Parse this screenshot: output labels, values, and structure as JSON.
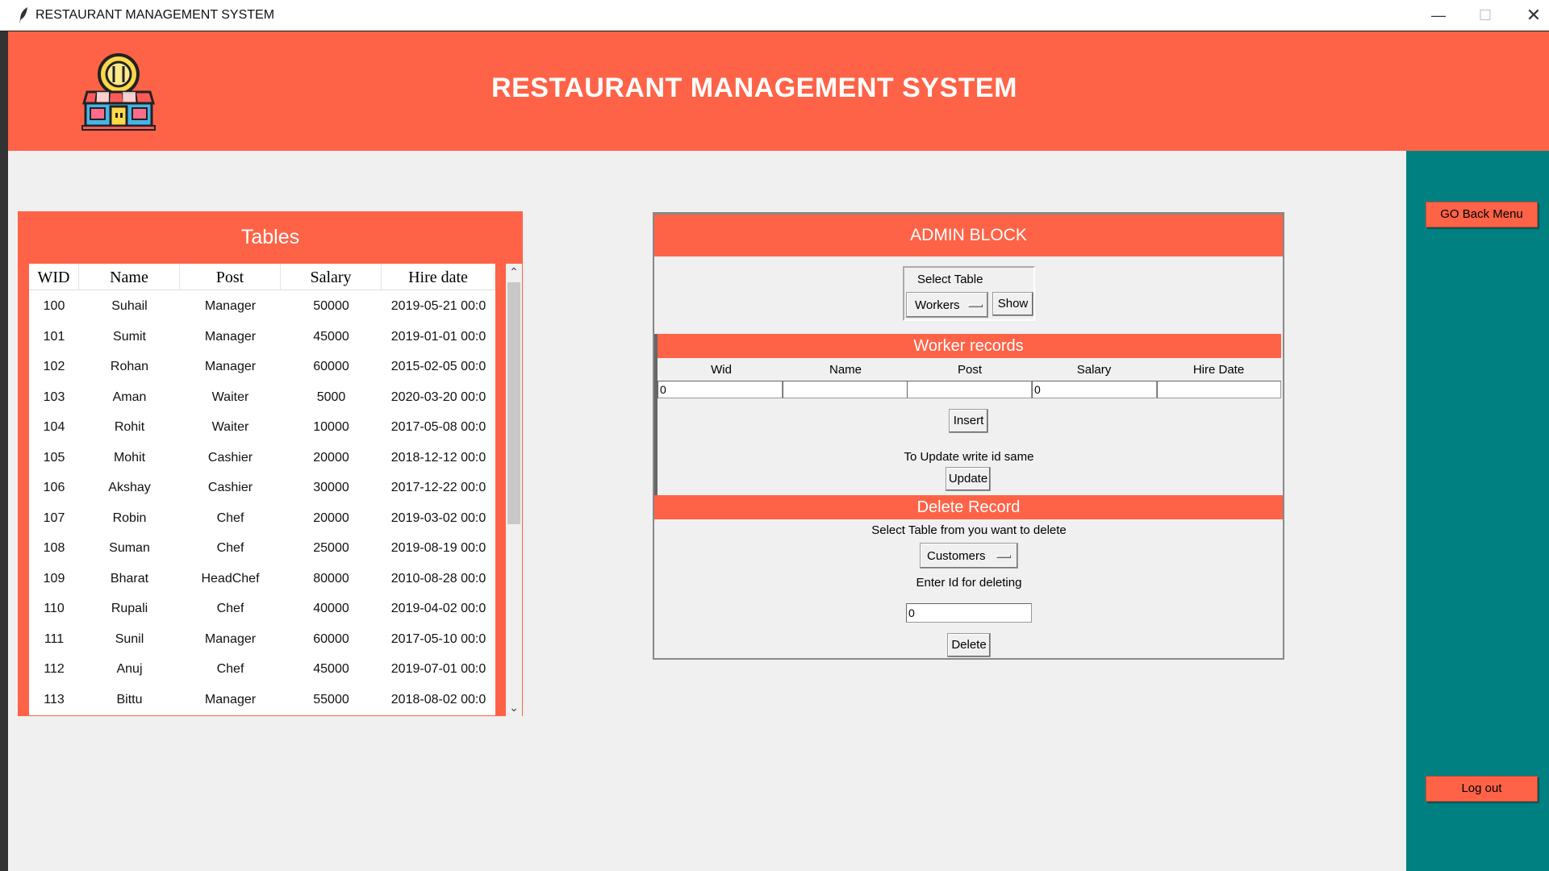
{
  "window": {
    "title": "RESTAURANT MANAGEMENT SYSTEM",
    "minimize": "—",
    "maximize": "☐",
    "close": "✕"
  },
  "header": {
    "title": "RESTAURANT MANAGEMENT SYSTEM"
  },
  "side": {
    "back_label": "GO Back Menu",
    "logout_label": "Log out"
  },
  "tables": {
    "title": "Tables",
    "columns": [
      "WID",
      "Name",
      "Post",
      "Salary",
      "Hire date"
    ],
    "rows": [
      [
        "100",
        "Suhail",
        "Manager",
        "50000",
        "2019-05-21 00:0"
      ],
      [
        "101",
        "Sumit",
        "Manager",
        "45000",
        "2019-01-01 00:0"
      ],
      [
        "102",
        "Rohan",
        "Manager",
        "60000",
        "2015-02-05 00:0"
      ],
      [
        "103",
        "Aman",
        "Waiter",
        "5000",
        "2020-03-20 00:0"
      ],
      [
        "104",
        "Rohit",
        "Waiter",
        "10000",
        "2017-05-08 00:0"
      ],
      [
        "105",
        "Mohit",
        "Cashier",
        "20000",
        "2018-12-12 00:0"
      ],
      [
        "106",
        "Akshay",
        "Cashier",
        "30000",
        "2017-12-22 00:0"
      ],
      [
        "107",
        "Robin",
        "Chef",
        "20000",
        "2019-03-02 00:0"
      ],
      [
        "108",
        "Suman",
        "Chef",
        "25000",
        "2019-08-19 00:0"
      ],
      [
        "109",
        "Bharat",
        "HeadChef",
        "80000",
        "2010-08-28 00:0"
      ],
      [
        "110",
        "Rupali",
        "Chef",
        "40000",
        "2019-04-02 00:0"
      ],
      [
        "111",
        "Sunil",
        "Manager",
        "60000",
        "2017-05-10 00:0"
      ],
      [
        "112",
        "Anuj",
        "Chef",
        "45000",
        "2019-07-01 00:0"
      ],
      [
        "113",
        "Bittu",
        "Manager",
        "55000",
        "2018-08-02 00:0"
      ]
    ]
  },
  "admin": {
    "title": "ADMIN BLOCK",
    "select_table_label": "Select Table",
    "select_table_value": "Workers",
    "show_label": "Show",
    "records_title": "Worker records",
    "fields": [
      {
        "label": "Wid",
        "value": "0"
      },
      {
        "label": "Name",
        "value": ""
      },
      {
        "label": "Post",
        "value": ""
      },
      {
        "label": "Salary",
        "value": "0"
      },
      {
        "label": "Hire Date",
        "value": ""
      }
    ],
    "insert_label": "Insert",
    "update_note": "To Update write id same",
    "update_label": "Update",
    "delete_title": "Delete Record",
    "delete_note": "Select Table from you want to delete",
    "delete_table_value": "Customers",
    "id_note": "Enter Id for deleting",
    "delete_id_value": "0",
    "delete_label": "Delete"
  },
  "colors": {
    "accent": "#ff6347",
    "side": "#008080",
    "background": "#f0f0f0"
  }
}
